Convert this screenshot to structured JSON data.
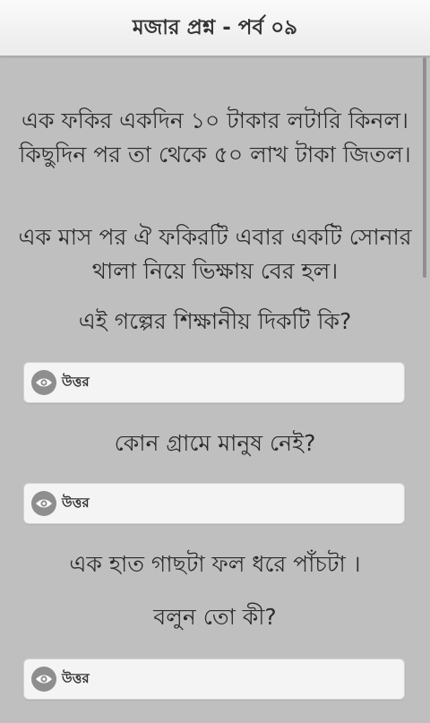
{
  "header": {
    "title": "মজার প্রশ্ন - পর্ব ০৯"
  },
  "questions": [
    {
      "paragraphs": [
        "এক ফকির একদিন ১০ টাকার লটারি কিনল। কিছুদিন পর তা থেকে ৫০ লাখ টাকা জিতল।",
        "এক মাস পর ঐ ফকিরটি এবার একটি সোনার থালা নিয়ে ভিক্ষায় বের হল।",
        "এই গল্পের শিক্ষানীয় দিকটি কি?"
      ],
      "answer_label": "উত্তর"
    },
    {
      "paragraphs": [
        "কোন গ্রামে মানুষ নেই?"
      ],
      "answer_label": "উত্তর"
    },
    {
      "paragraphs": [
        "এক হাত গাছটা ফল ধরে পাঁচটা ।",
        "বলুন তো কী?"
      ],
      "answer_label": "উত্তর"
    }
  ],
  "icons": {
    "answer_icon": "eye-icon"
  },
  "colors": {
    "background": "#bfbfbf",
    "header_bg": "#f2f2f2",
    "button_bg": "#f4f4f4",
    "icon_bg": "#8e8e8e",
    "text": "#2b2b2b"
  }
}
